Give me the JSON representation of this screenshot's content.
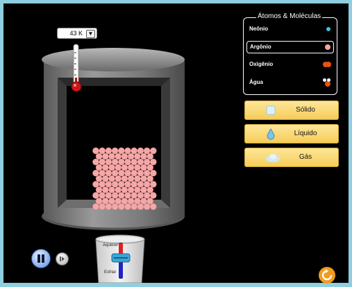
{
  "thermometer": {
    "value": "43 K",
    "dropdown_symbol": "▼"
  },
  "species_panel": {
    "title": "Átomos & Moléculas",
    "items": [
      {
        "label": "Neônio",
        "icon": "neon-atom-icon",
        "color": "#34c7e8"
      },
      {
        "label": "Argônio",
        "icon": "argon-atom-icon",
        "color": "#f2a5a5",
        "selected": true
      },
      {
        "label": "Oxigênio",
        "icon": "oxygen-molecule-icon",
        "color": "#e8520f"
      },
      {
        "label": "Água",
        "icon": "water-molecule-icon",
        "color": "#e8520f"
      }
    ]
  },
  "phase_buttons": [
    {
      "label": "Sólido",
      "icon": "ice-cube-icon"
    },
    {
      "label": "Líquido",
      "icon": "droplet-icon"
    },
    {
      "label": "Gás",
      "icon": "cloud-icon"
    }
  ],
  "heater": {
    "heat_label": "Aquecer",
    "cool_label": "Esfriar"
  },
  "colors": {
    "particle": "#f4a7a7",
    "button_yellow": "#f6cc58",
    "background": "#000000",
    "frame": "#8ecfe0"
  },
  "playback": {
    "pause_icon": "pause-icon",
    "step_icon": "step-forward-icon",
    "reset_icon": "reset-icon"
  }
}
